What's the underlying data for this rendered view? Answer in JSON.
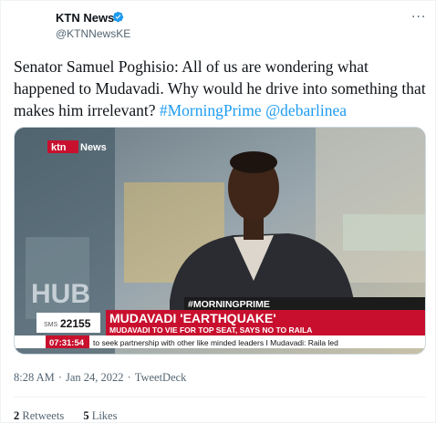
{
  "author": {
    "display_name": "KTN News",
    "handle": "@KTNNewsKE",
    "verified_icon": "verified-badge-icon",
    "more_icon": "more-options-icon",
    "more_glyph": "···"
  },
  "tweet": {
    "text": "Senator Samuel Poghisio: All of us are wondering what happened to Mudavadi. Why would he drive into something that makes him irrelevant? ",
    "hashtag": "#MorningPrime",
    "mention": "@debarlinea"
  },
  "media": {
    "channel_logo_ktn": "ktn",
    "channel_logo_news": "News",
    "show_banner": "#MORNINGPRIME",
    "sms_label": "SMS",
    "sms_number": "22155",
    "headline": "MUDAVADI 'EARTHQUAKE'",
    "subheadline": "MUDAVADI TO VIE FOR TOP SEAT, SAYS NO TO RAILA",
    "clock": "07:31:54",
    "ticker": "to seek partnership with other like minded leaders  I Mudavadi: Raila led",
    "backdrop_letters": "HUB"
  },
  "meta": {
    "time": "8:28 AM",
    "separator": "·",
    "date": "Jan 24, 2022",
    "source": "TweetDeck"
  },
  "stats": {
    "retweets_count": "2",
    "retweets_label": "Retweets",
    "likes_count": "5",
    "likes_label": "Likes"
  },
  "colors": {
    "link": "#1d9bf0",
    "verified": "#1d9bf0",
    "lower_third_red": "#c8102e"
  }
}
